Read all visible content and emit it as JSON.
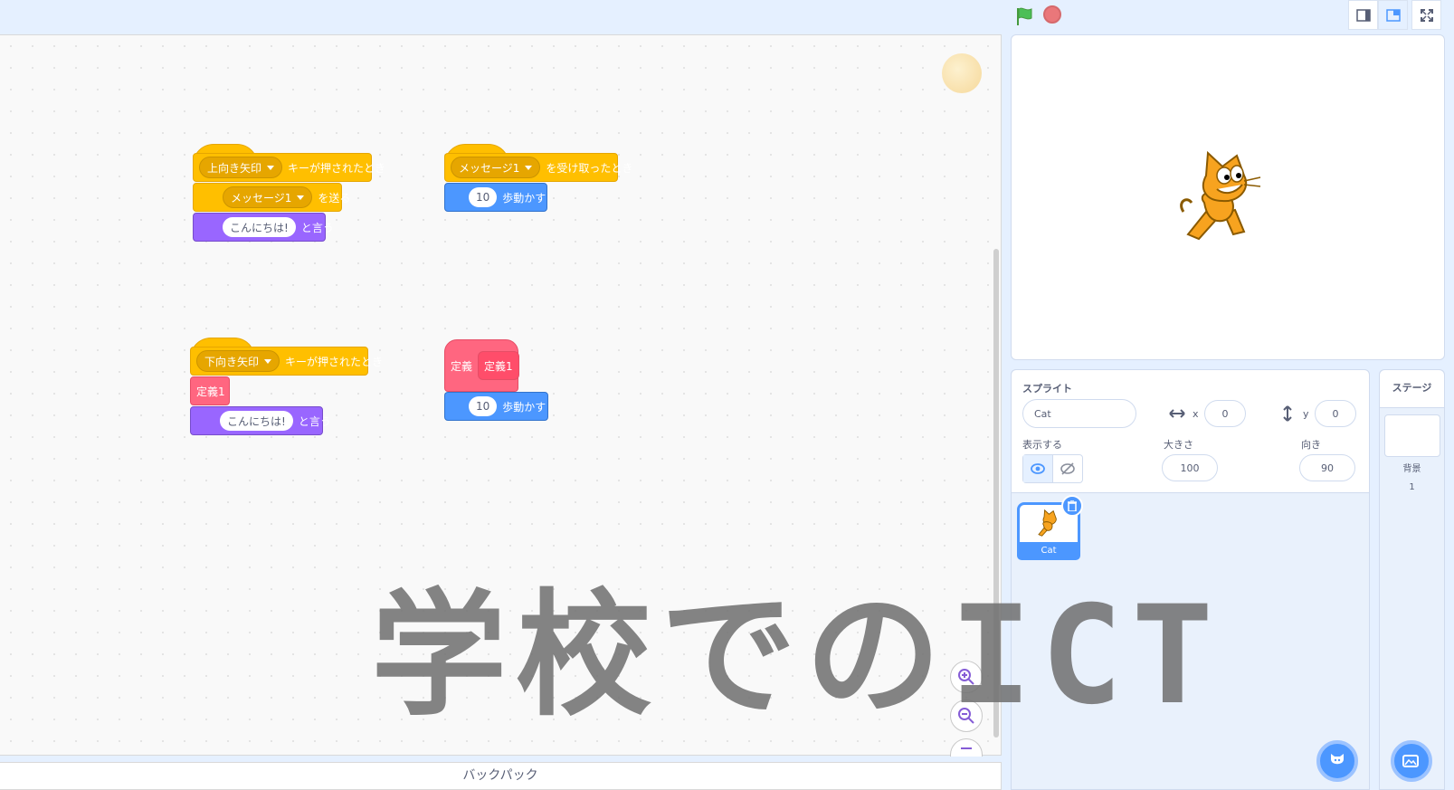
{
  "topbar": {
    "green_flag_icon": "green-flag-icon",
    "stop_icon": "stop-sign-icon",
    "layout_buttons": [
      "small-stage-icon",
      "normal-stage-icon",
      "fullscreen-icon"
    ]
  },
  "scripts": {
    "s1": {
      "key": "上向き矢印",
      "hat_text": "キーが押されたとき",
      "msg": "メッセージ1",
      "send_text": "を送る",
      "say_value": "こんにちは!",
      "say_text": "と言う"
    },
    "s2": {
      "msg": "メッセージ1",
      "receive_text": "を受け取ったとき",
      "steps": "10",
      "move_text": "歩動かす"
    },
    "s3": {
      "key": "下向き矢印",
      "hat_text": "キーが押されたとき",
      "call": "定義1",
      "say_value": "こんにちは!",
      "say_text": "と言う"
    },
    "s4": {
      "define_label": "定義",
      "define_name": "定義1",
      "steps": "10",
      "move_text": "歩動かす"
    }
  },
  "backpack": {
    "label": "バックパック"
  },
  "sprite_info": {
    "title": "スプライト",
    "name": "Cat",
    "x_label": "x",
    "x_value": "0",
    "y_label": "y",
    "y_value": "0",
    "show_label": "表示する",
    "size_label": "大きさ",
    "size_value": "100",
    "direction_label": "向き",
    "direction_value": "90"
  },
  "sprite_list": [
    {
      "name": "Cat",
      "selected": true
    }
  ],
  "stage_pane": {
    "title": "ステージ",
    "backdrop_label": "背景",
    "backdrop_count": "1"
  },
  "watermark": "学校でのICT",
  "colors": {
    "events": "#ffbf00",
    "motion": "#4c97ff",
    "looks": "#9966ff",
    "procedures": "#ff6680"
  }
}
